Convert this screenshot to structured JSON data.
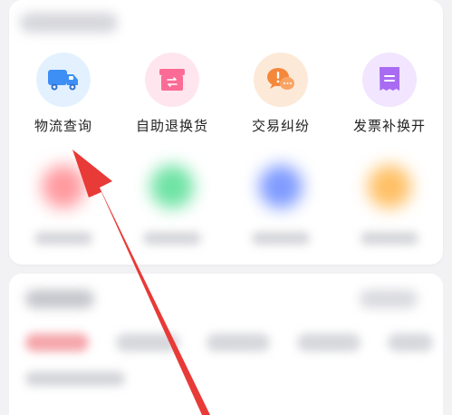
{
  "quick_actions": {
    "items": [
      {
        "label": "物流查询",
        "icon": "truck-icon",
        "bg": "#e3f1ff",
        "fg": "#3d8ff5"
      },
      {
        "label": "自助退换货",
        "icon": "return-box-icon",
        "bg": "#ffe6ee",
        "fg": "#fb6b95"
      },
      {
        "label": "交易纠纷",
        "icon": "chat-alert-icon",
        "bg": "#fde9d8",
        "fg": "#f5873b"
      },
      {
        "label": "发票补换开",
        "icon": "invoice-icon",
        "bg": "#f1e5ff",
        "fg": "#a86bf2"
      }
    ]
  },
  "blurred_row": {
    "colors": [
      "#ff9aa0",
      "#6fe3a4",
      "#7f9bff",
      "#ffc066"
    ]
  },
  "annotation": {
    "arrow_color": "#e83a37"
  }
}
